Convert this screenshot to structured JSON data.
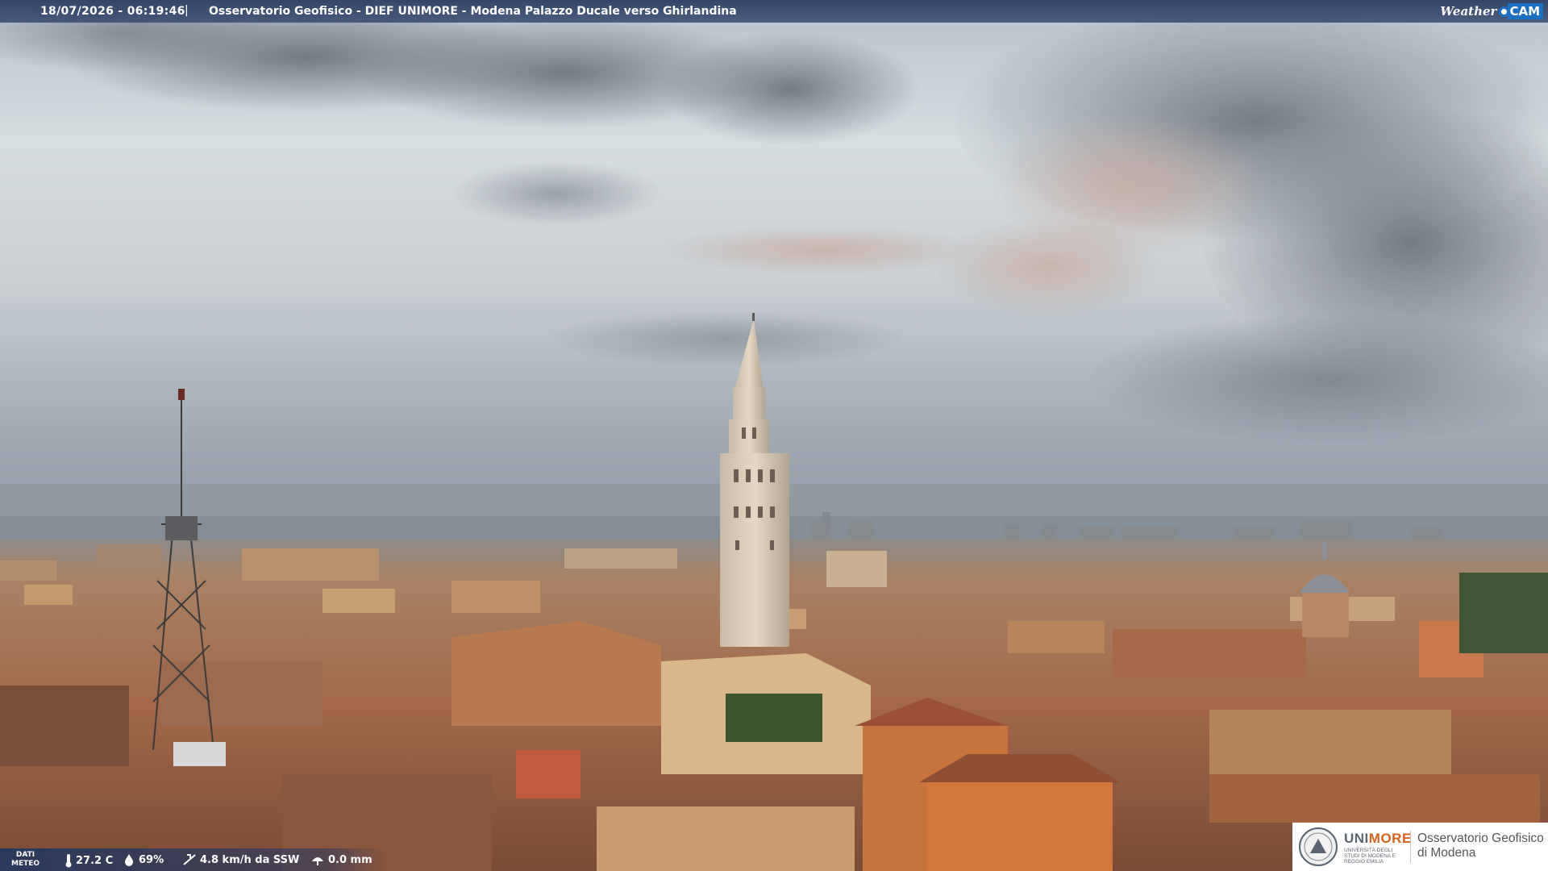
{
  "caption": {
    "timestamp": "18/07/2026 - 06:19:46",
    "separator": "|",
    "title": "Osservatorio Geofisico - DIEF UNIMORE - Modena Palazzo Ducale verso Ghirlandina"
  },
  "brand": {
    "word": "Weather",
    "cam": "CAM"
  },
  "weather": {
    "dati_line1": "DATI",
    "dati_line2": "METEO",
    "temperature": "27.2 C",
    "humidity": "69%",
    "wind": "4.8 km/h da SSW",
    "rain": "0.0 mm",
    "icons": [
      "thermometer-icon",
      "humidity-icon",
      "wind-icon",
      "rain-icon"
    ]
  },
  "logo": {
    "uni_a": "UNI",
    "uni_b": "MORE",
    "small_line": "UNIVERSITÀ DEGLI STUDI DI MODENA E REGGIO EMILIA",
    "obs_line1": "Osservatorio Geofisico",
    "obs_line2": "di Modena"
  },
  "colors": {
    "caption_bar": "#2f4a78",
    "brand_blue": "#1d6fc2",
    "unimore_orange": "#d8601e",
    "sky_top": "#c9d2d8",
    "roofs": "#a86a4a"
  }
}
